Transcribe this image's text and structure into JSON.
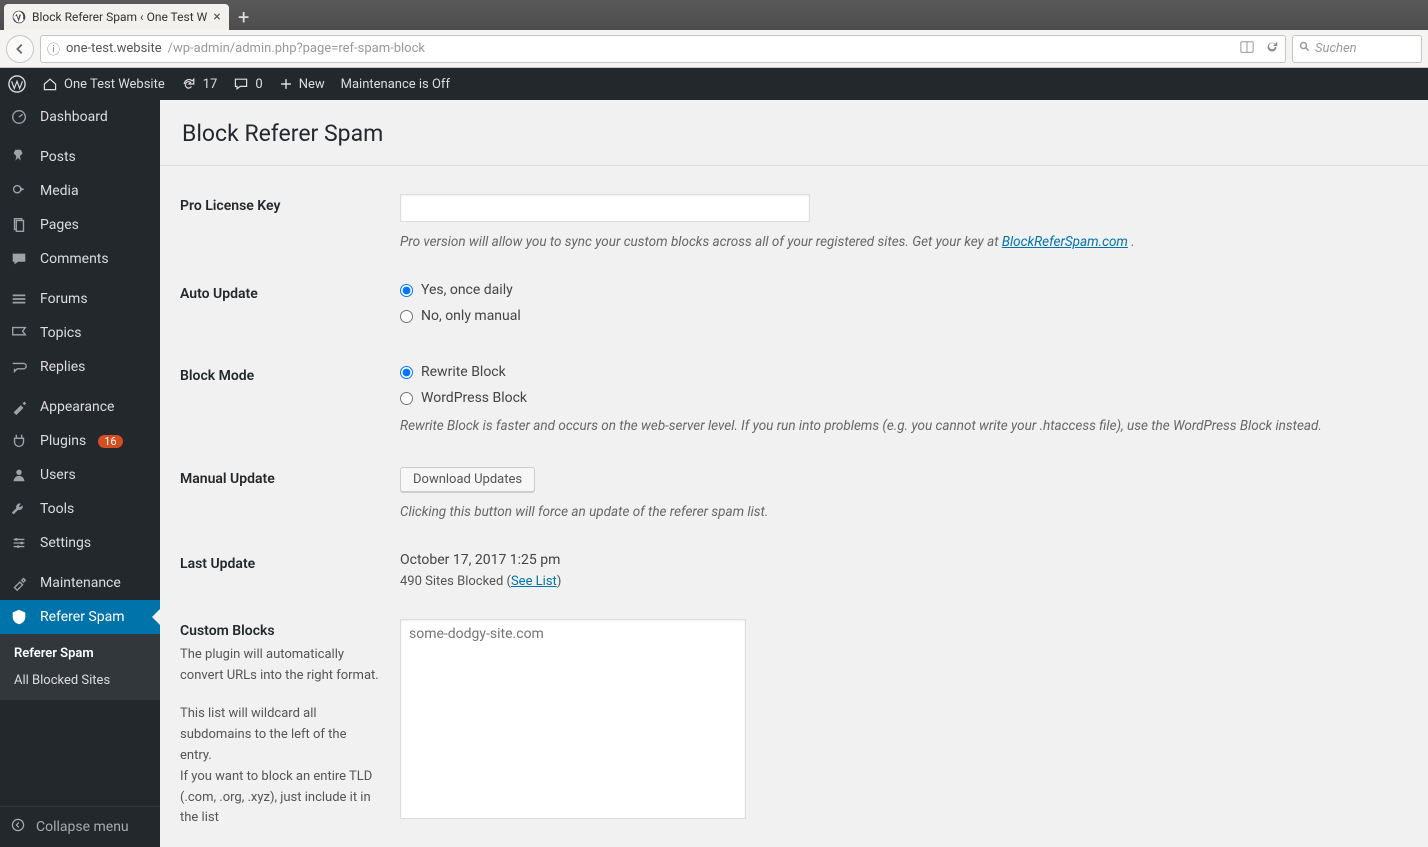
{
  "browser": {
    "tab_title": "Block Referer Spam ‹ One Test W",
    "url_host": "one-test.website",
    "url_path": "/wp-admin/admin.php?page=ref-spam-block",
    "search_placeholder": "Suchen"
  },
  "adminbar": {
    "site_name": "One Test Website",
    "updates": "17",
    "comments": "0",
    "new_label": "New",
    "maintenance": "Maintenance is Off"
  },
  "menu": {
    "dashboard": "Dashboard",
    "posts": "Posts",
    "media": "Media",
    "pages": "Pages",
    "comments": "Comments",
    "forums": "Forums",
    "topics": "Topics",
    "replies": "Replies",
    "appearance": "Appearance",
    "plugins": "Plugins",
    "plugins_badge": "16",
    "users": "Users",
    "tools": "Tools",
    "settings": "Settings",
    "maintenance": "Maintenance",
    "referer_spam": "Referer Spam",
    "sub_referer_spam": "Referer Spam",
    "sub_all_blocked": "All Blocked Sites",
    "collapse": "Collapse menu"
  },
  "page": {
    "title": "Block Referer Spam",
    "fields": {
      "license": {
        "label": "Pro License Key",
        "value": "",
        "desc_prefix": "Pro version will allow you to sync your custom blocks across all of your registered sites. Get your key at ",
        "desc_link": "BlockReferSpam.com",
        "desc_suffix": " ."
      },
      "auto_update": {
        "label": "Auto Update",
        "opt_yes": "Yes, once daily",
        "opt_no": "No, only manual"
      },
      "block_mode": {
        "label": "Block Mode",
        "opt_rewrite": "Rewrite Block",
        "opt_wp": "WordPress Block",
        "desc": "Rewrite Block is faster and occurs on the web-server level. If you run into problems (e.g. you cannot write your .htaccess file), use the WordPress Block instead."
      },
      "manual_update": {
        "label": "Manual Update",
        "button": "Download Updates",
        "desc": "Clicking this button will force an update of the referer spam list."
      },
      "last_update": {
        "label": "Last Update",
        "value": "October 17, 2017 1:25 pm",
        "note_prefix": "490 Sites Blocked (",
        "note_link": "See List",
        "note_suffix": ")"
      },
      "custom_blocks": {
        "label": "Custom Blocks",
        "help1": "The plugin will automatically convert URLs into the right format.",
        "help2": "This list will wildcard all subdomains to the left of the entry.",
        "help3": "If you want to block an entire TLD (.com, .org, .xyz), just include it in the list",
        "placeholder": "some-dodgy-site.com"
      }
    }
  }
}
